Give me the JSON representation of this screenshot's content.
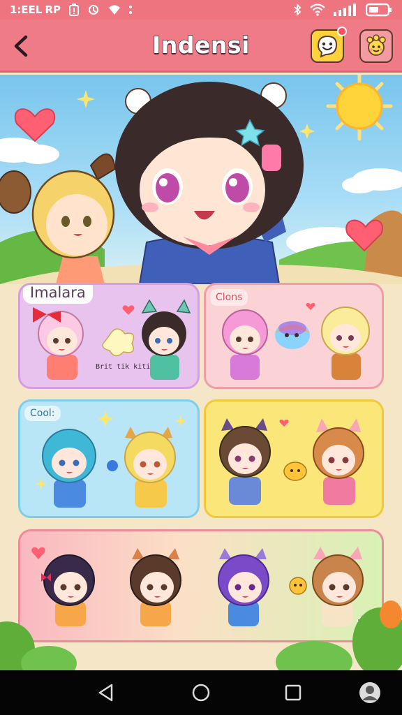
{
  "status_bar": {
    "time": "1:EEL",
    "carrier": "RP",
    "icons": [
      "battery-alert-icon",
      "sync-icon",
      "location-icon",
      "dots-icon",
      "bluetooth-icon",
      "wifi-icon",
      "signal-icon",
      "battery-icon"
    ]
  },
  "app_bar": {
    "title": "Indensi",
    "icons": [
      "back-arrow-icon",
      "smiley-icon",
      "mascot-icon"
    ]
  },
  "hero": {
    "scene": [
      "sun-icon",
      "heart-icon",
      "star-icon",
      "cloud-icon"
    ]
  },
  "cards": {
    "imalara": {
      "label": "Imalara",
      "bg": "#e8c3ee",
      "border": "#d39ee0",
      "stamp_text": "Brit tik kiti"
    },
    "clons": {
      "label": "Clons",
      "bg": "#fbd2d6",
      "border": "#ef9ea6"
    },
    "cool": {
      "label": "Cool:",
      "bg": "#b9e6f7",
      "border": "#7dcdec"
    },
    "yellow": {
      "label": "",
      "bg": "#fbe779",
      "border": "#f2c93a"
    },
    "wide": {
      "label": "",
      "bg_from": "#f9b8c1",
      "bg_to": "#d8f1b4",
      "border": "#ee8b99"
    }
  },
  "colors": {
    "header": "#ef7b86",
    "status": "#ee7480",
    "sky": "#78c5ec",
    "grass": "#6fbf4a"
  },
  "nav_bar": {
    "icons": [
      "back-triangle-icon",
      "home-circle-icon",
      "recents-square-icon",
      "assistant-icon"
    ]
  }
}
